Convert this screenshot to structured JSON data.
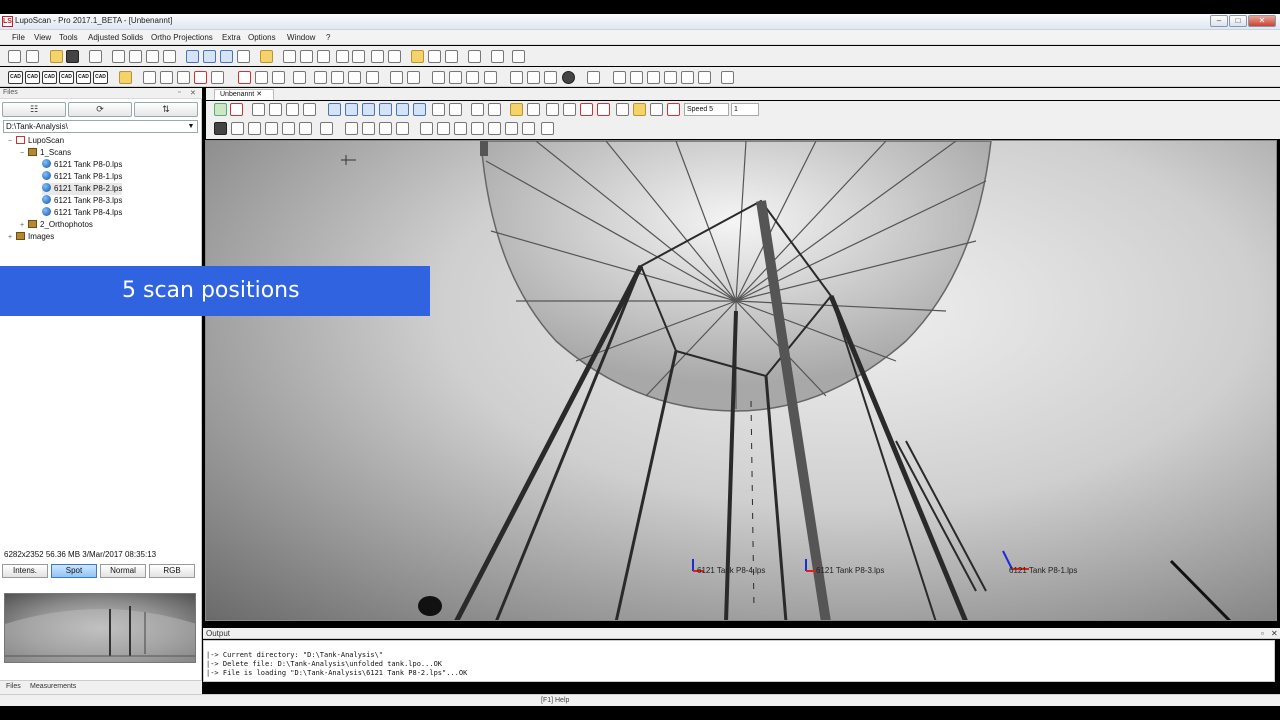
{
  "window": {
    "title": "LupoScan - Pro 2017.1_BETA - [Unbenannt]",
    "app_icon": "LS"
  },
  "menu": [
    "File",
    "View",
    "Tools",
    "Adjusted Solids",
    "Ortho Projections",
    "Extra",
    "Options",
    "Window",
    "?"
  ],
  "files_panel": {
    "title": "Files",
    "path": "D:\\Tank-Analysis\\",
    "tree": {
      "root": "LupoScan",
      "scans_folder": "1_Scans",
      "scans": [
        "6121 Tank P8-0.lps",
        "6121 Tank P8-1.lps",
        "6121 Tank P8-2.lps",
        "6121 Tank P8-3.lps",
        "6121 Tank P8-4.lps"
      ],
      "ortho_folder": "2_Orthophotos",
      "images_folder": "Images"
    },
    "file_info": "6282x2352  56.36 MB  3/Mar/2017  08:35:13",
    "modes": [
      "Intens.",
      "Spot",
      "Normal",
      "RGB"
    ],
    "selected_mode": "Spot",
    "bottom_tabs": [
      "Files",
      "Measurements"
    ]
  },
  "view": {
    "tab": "Unbenannt",
    "speed": "Speed 5",
    "step": "1",
    "scan_labels": [
      "6121 Tank P8-4.lps",
      "6121 Tank P8-3.lps",
      "6121 Tank P8-1.lps"
    ]
  },
  "overlay": {
    "banner": "5 scan positions"
  },
  "output": {
    "title": "Output",
    "lines": [
      "|-> Current directory: \"D:\\Tank-Analysis\\\"",
      "|-> Delete file: D:\\Tank-Analysis\\unfolded tank.lpo...OK",
      "|-> File is loading \"D:\\Tank-Analysis\\6121 Tank P8-2.lps\"...OK"
    ]
  },
  "status": {
    "help": "[F1] Help"
  },
  "colors": {
    "banner": "#2f63e0",
    "selected_mode": "#8fc4f6"
  }
}
